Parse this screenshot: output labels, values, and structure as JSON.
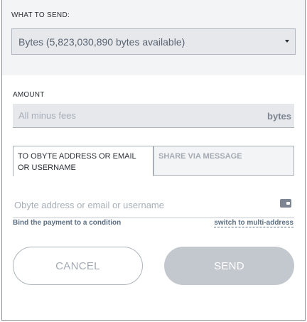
{
  "asset": {
    "label": "WHAT TO SEND:",
    "selected": "Bytes (5,823,030,890 bytes available)"
  },
  "amount": {
    "label": "AMOUNT",
    "placeholder": "All minus fees",
    "unit": "bytes"
  },
  "tabs": [
    {
      "label": "TO OBYTE ADDRESS OR EMAIL OR USERNAME",
      "active": true
    },
    {
      "label": "SHARE VIA MESSAGE",
      "active": false
    }
  ],
  "recipient": {
    "placeholder": "Obyte address or email or username",
    "icon": "wallet-icon"
  },
  "links": {
    "bind": "Bind the payment to a condition",
    "switch": "switch to multi-address"
  },
  "buttons": {
    "cancel": "CANCEL",
    "send": "SEND"
  }
}
